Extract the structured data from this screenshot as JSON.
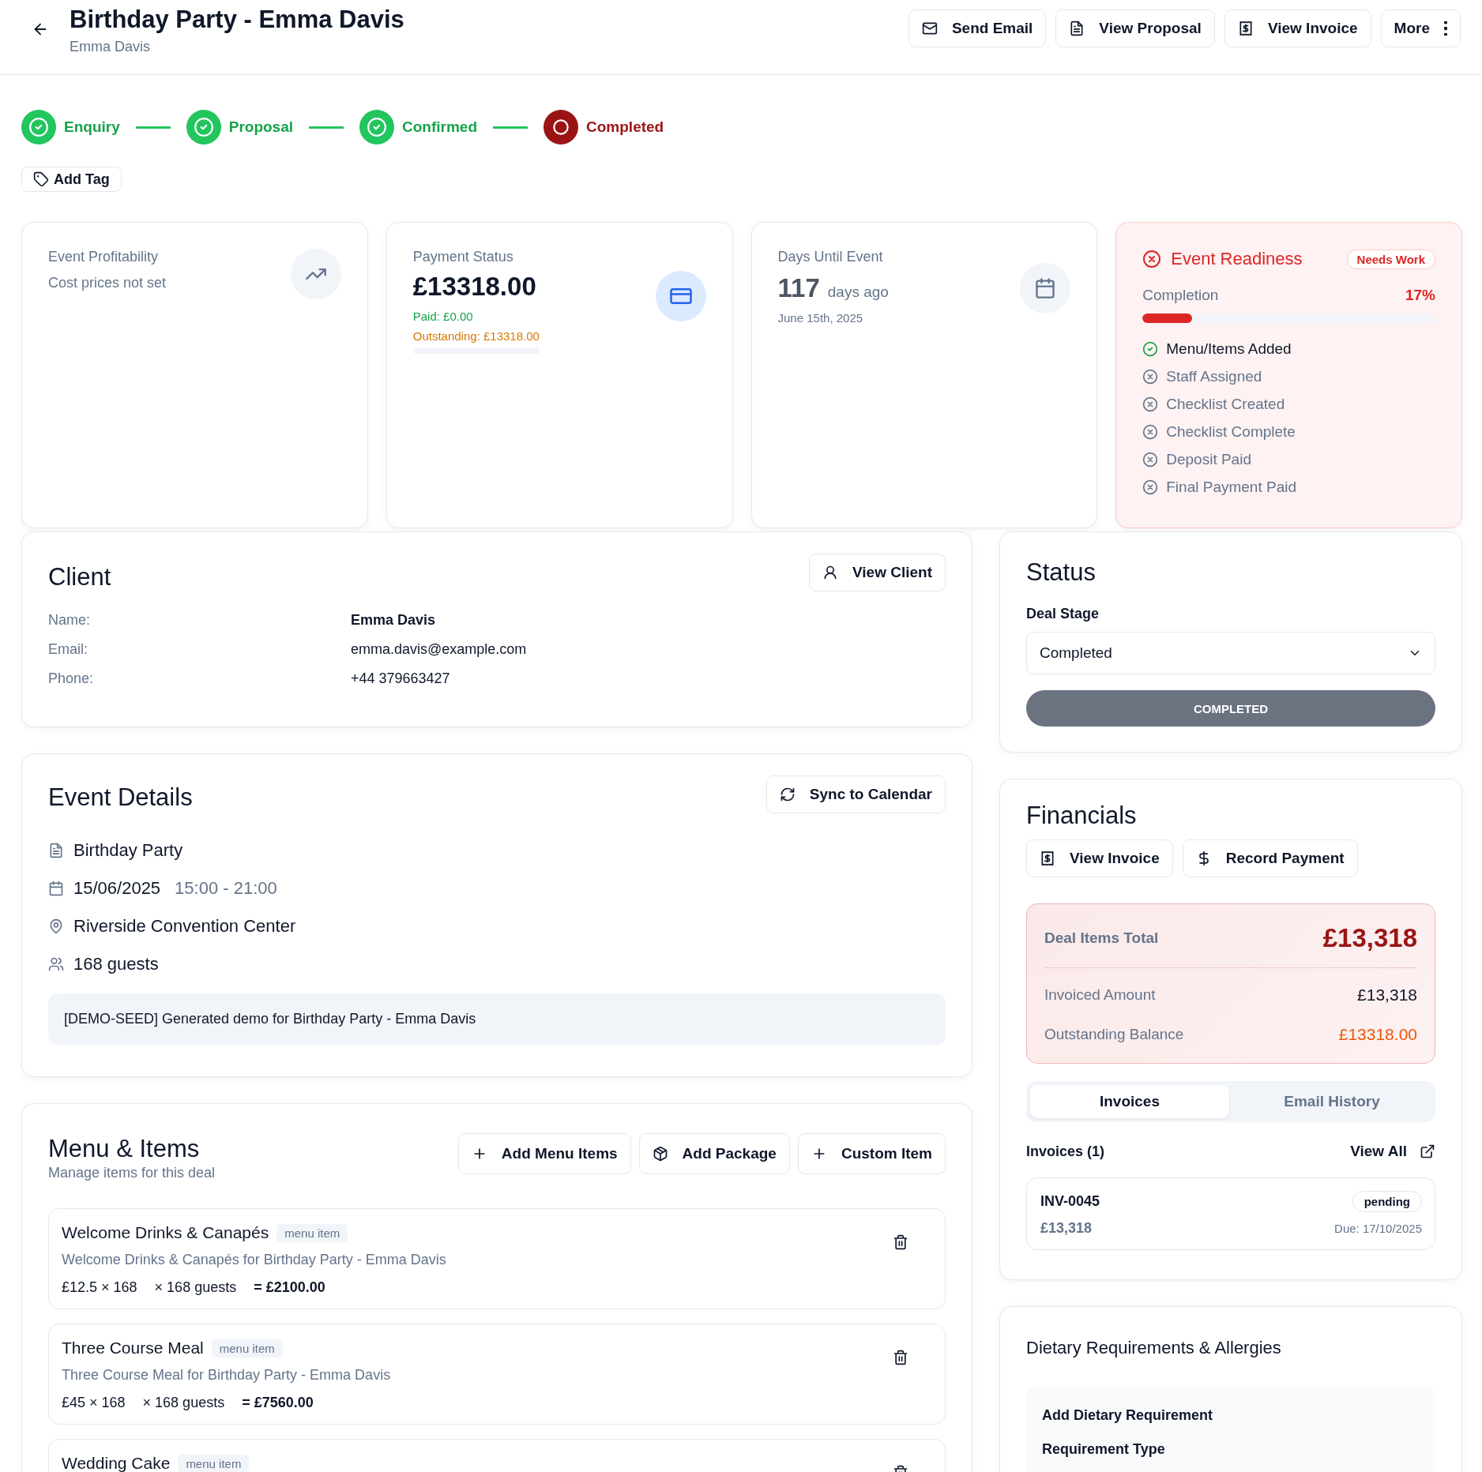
{
  "header": {
    "title": "Birthday Party - Emma Davis",
    "subtitle": "Emma Davis",
    "actions": [
      "Send Email",
      "View Proposal",
      "View Invoice",
      "More"
    ]
  },
  "stages": [
    {
      "label": "Enquiry",
      "done": true
    },
    {
      "label": "Proposal",
      "done": true
    },
    {
      "label": "Confirmed",
      "done": true
    },
    {
      "label": "Completed",
      "done": false
    }
  ],
  "add_tag": "Add Tag",
  "profitability": {
    "title": "Event Profitability",
    "note": "Cost prices not set"
  },
  "payment": {
    "title": "Payment Status",
    "amount": "£13318.00",
    "paid": "Paid: £0.00",
    "outstanding": "Outstanding: £13318.00",
    "level": 0
  },
  "days": {
    "title": "Days Until Event",
    "number": "117",
    "unit": "days ago",
    "date": "June 15th, 2025"
  },
  "readiness": {
    "title": "Event Readiness",
    "badge": "Needs Work",
    "completion_label": "Completion",
    "completion_value": "17%",
    "level": 0.17,
    "checks": [
      {
        "label": "Menu/Items Added",
        "done": true
      },
      {
        "label": "Staff Assigned",
        "done": false
      },
      {
        "label": "Checklist Created",
        "done": false
      },
      {
        "label": "Checklist Complete",
        "done": false
      },
      {
        "label": "Deposit Paid",
        "done": false
      },
      {
        "label": "Final Payment Paid",
        "done": false
      }
    ]
  },
  "client": {
    "title": "Client",
    "button": "View Client",
    "fields": [
      {
        "label": "Name:",
        "value": "Emma Davis"
      },
      {
        "label": "Email:",
        "value": "emma.davis@example.com"
      },
      {
        "label": "Phone:",
        "value": "+44 379663427"
      }
    ]
  },
  "status": {
    "title": "Status",
    "field_label": "Deal Stage",
    "value": "Completed",
    "badge": "COMPLETED"
  },
  "event": {
    "title": "Event Details",
    "button": "Sync to Calendar",
    "type": "Birthday Party",
    "date": "15/06/2025",
    "time": "15:00 - 21:00",
    "venue": "Riverside Convention Center",
    "guests": "168 guests",
    "note": "[DEMO-SEED] Generated demo for Birthday Party - Emma Davis"
  },
  "financials": {
    "title": "Financials",
    "buttons": [
      "View Invoice",
      "Record Payment"
    ],
    "total_label": "Deal Items Total",
    "total": "£13,318",
    "invoiced_label": "Invoiced Amount",
    "invoiced": "£13,318",
    "outstanding_label": "Outstanding Balance",
    "outstanding": "£13318.00",
    "tabs": [
      {
        "label": "Invoices",
        "selected": true
      },
      {
        "label": "Email History",
        "selected": false
      }
    ],
    "invoices_label": "Invoices (1)",
    "view_all": "View All",
    "invoice": {
      "number": "INV-0045",
      "amount": "£13,318",
      "status": "pending",
      "due": "Due: 17/10/2025"
    }
  },
  "menu": {
    "title": "Menu & Items",
    "subtitle": "Manage items for this deal",
    "buttons": [
      "Add Menu Items",
      "Add Package",
      "Custom Item"
    ],
    "items": [
      {
        "name": "Welcome Drinks & Canapés",
        "badge": "menu item",
        "description": "Welcome Drinks & Canapés for Birthday Party - Emma Davis",
        "price": "£12.5 × 168",
        "guests": "× 168 guests",
        "total": "= £2100.00"
      },
      {
        "name": "Three Course Meal",
        "badge": "menu item",
        "description": "Three Course Meal for Birthday Party - Emma Davis",
        "price": "£45 × 168",
        "guests": "× 168 guests",
        "total": "= £7560.00"
      },
      {
        "name": "Wedding Cake",
        "badge": "menu item"
      }
    ]
  },
  "dietary": {
    "title": "Dietary Requirements & Allergies",
    "form_title": "Add Dietary Requirement",
    "field_label": "Requirement Type"
  }
}
